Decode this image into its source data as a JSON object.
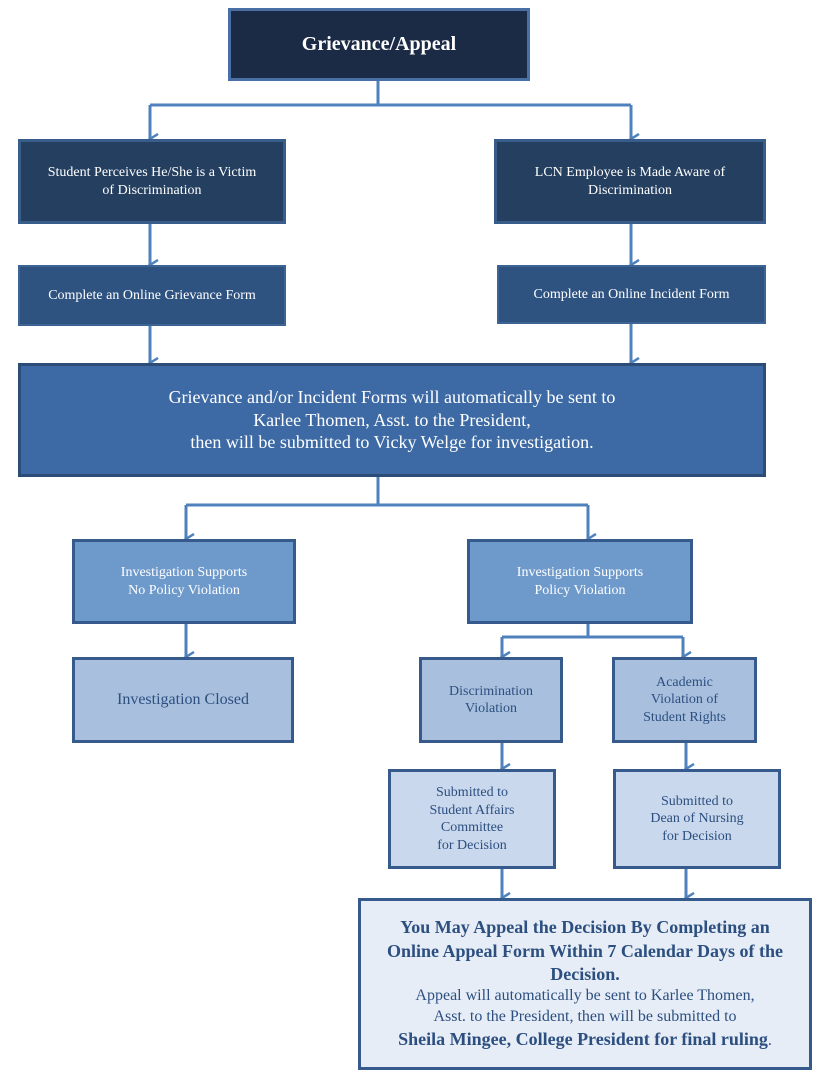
{
  "title": "Grievance/Appeal",
  "colors": {
    "connector": "#4f81bd",
    "dark_navy": "#1c2b45",
    "navy": "#243f60",
    "blue": "#3d6aa4",
    "mid_blue": "#6e99cb",
    "light_blue": "#a8c0de",
    "pale_blue": "#c9d8ec",
    "text_blue": "#2c4f80"
  },
  "nodes": {
    "root": "Grievance/Appeal",
    "student_victim": "Student Perceives He/She is a Victim\nof Discrimination",
    "employee_aware": "LCN Employee is Made Aware of\nDiscrimination",
    "grievance_form": "Complete an Online Grievance Form",
    "incident_form": "Complete an Online Incident Form",
    "forms_sent": "Grievance and/or Incident Forms will automatically be sent to\nKarlee Thomen, Asst. to the President,\nthen will be submitted to Vicky Welge for investigation.",
    "no_violation": "Investigation Supports\nNo Policy Violation",
    "violation": "Investigation Supports\nPolicy Violation",
    "closed": "Investigation Closed",
    "discrimination_violation": "Discrimination\nViolation",
    "academic_violation": "Academic\nViolation of\nStudent Rights",
    "student_affairs": "Submitted to\nStudent Affairs\nCommittee\nfor Decision",
    "dean_nursing": "Submitted to\nDean of Nursing\nfor Decision",
    "appeal": {
      "heading": "You May Appeal the Decision By Completing an Online Appeal Form Within 7 Calendar Days of the Decision.",
      "body": "Appeal will automatically be sent to Karlee Thomen,\nAsst. to the President, then will be submitted to",
      "final_bold": "Sheila Mingee, College President for final ruling",
      "final_punct": "."
    }
  }
}
